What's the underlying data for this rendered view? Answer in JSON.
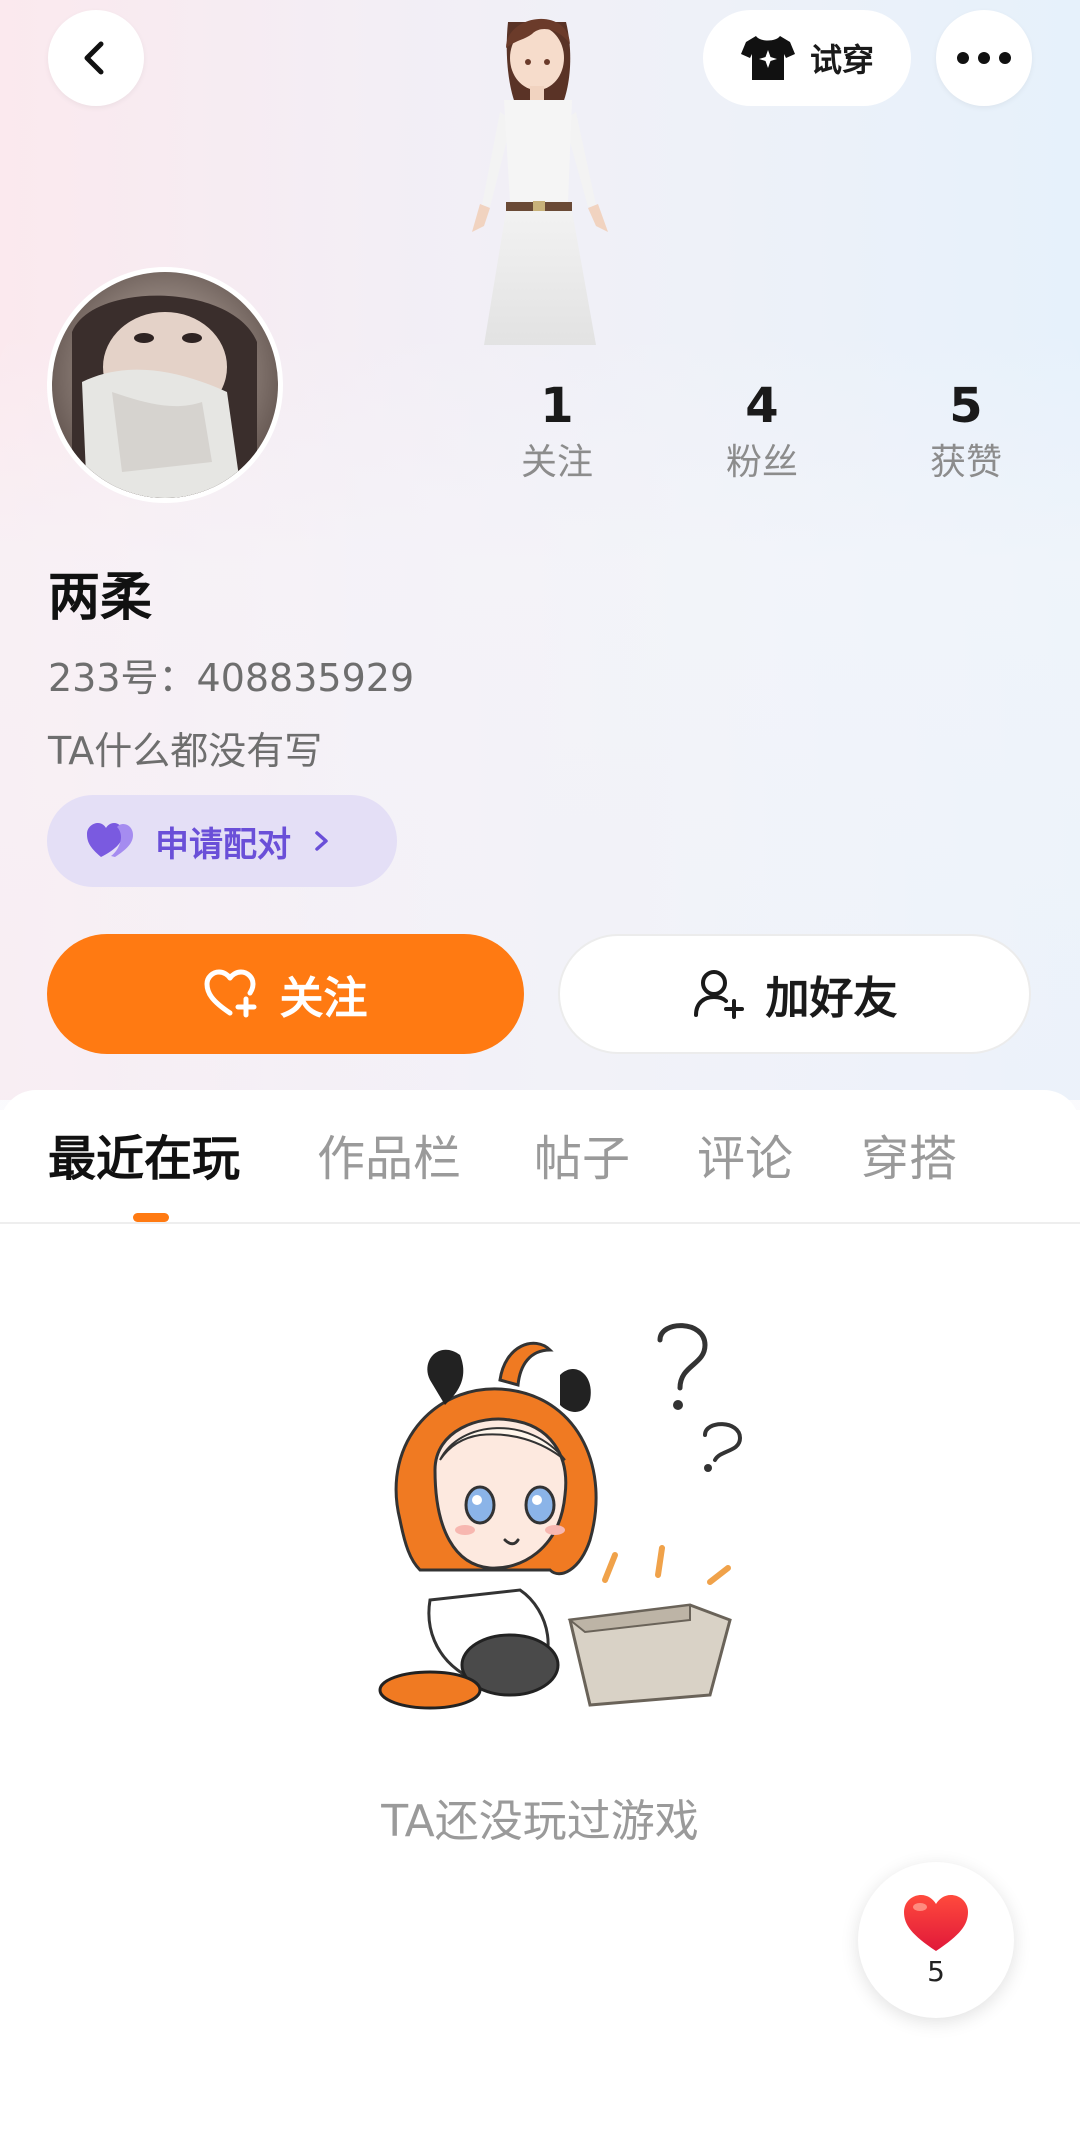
{
  "header": {
    "back_icon": "chevron-left-icon",
    "tryon_label": "试穿",
    "tryon_icon": "shirt-sparkle-icon",
    "more_icon": "more-dots-icon"
  },
  "profile": {
    "name": "两柔",
    "id_text": "233号：408835929",
    "bio": "TA什么都没有写",
    "stats": [
      {
        "value": "1",
        "label": "关注"
      },
      {
        "value": "4",
        "label": "粉丝"
      },
      {
        "value": "5",
        "label": "获赞"
      }
    ]
  },
  "actions": {
    "pair_label": "申请配对",
    "follow_label": "关注",
    "add_friend_label": "加好友"
  },
  "tabs": [
    {
      "label": "最近在玩",
      "active": true
    },
    {
      "label": "作品栏",
      "active": false
    },
    {
      "label": "帖子",
      "active": false
    },
    {
      "label": "评论",
      "active": false
    },
    {
      "label": "穿搭",
      "active": false
    }
  ],
  "empty_state": {
    "text": "TA还没玩过游戏"
  },
  "like_float": {
    "count": "5",
    "icon": "heart-icon"
  },
  "colors": {
    "accent": "#ff7a12",
    "pair_bg": "#e4dff6",
    "pair_text": "#6a4fd8"
  }
}
